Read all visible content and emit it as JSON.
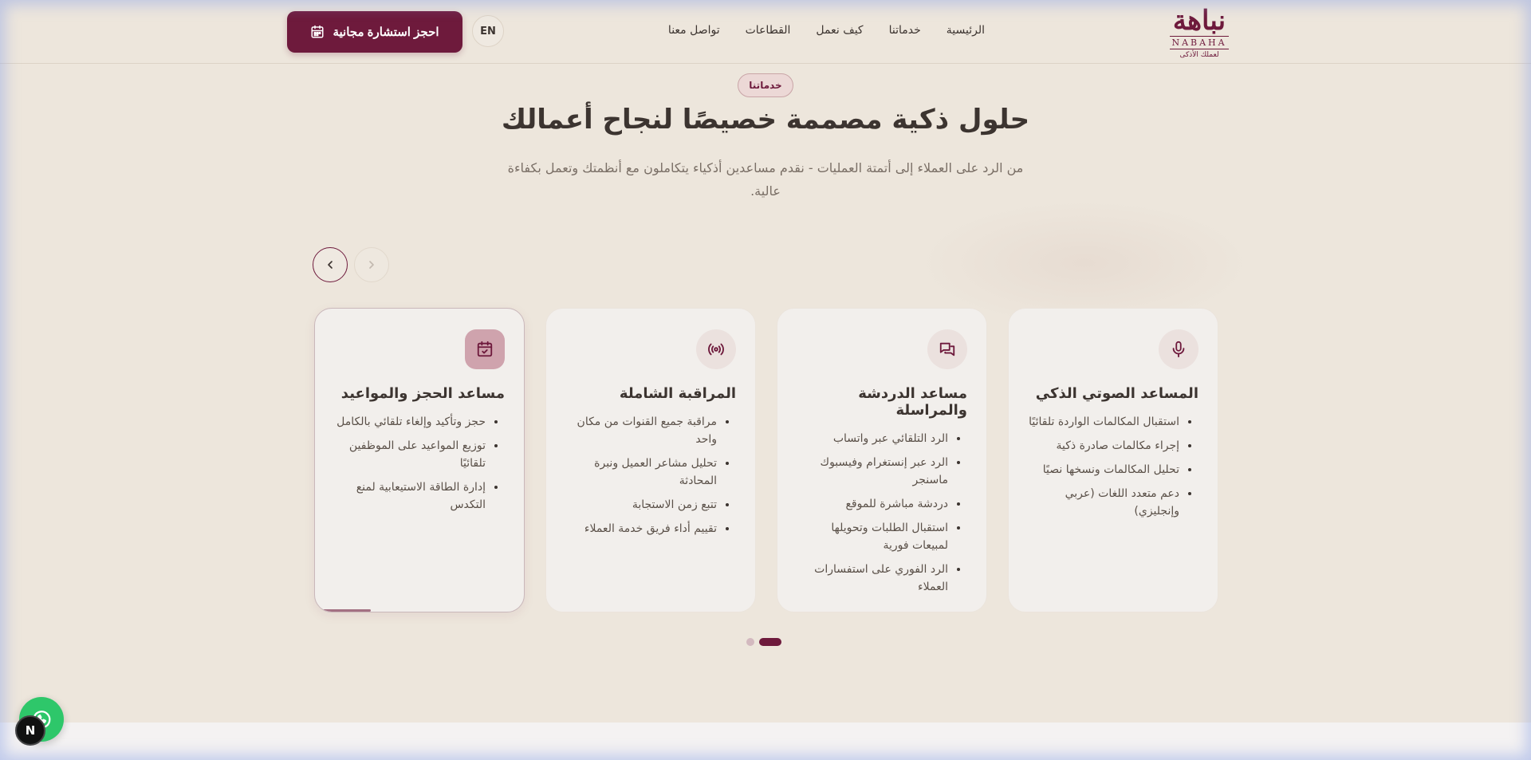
{
  "header": {
    "logo_ar": "نباهة",
    "logo_en": "NABAHA",
    "logo_tagline": "لعملك الأذكى",
    "nav": [
      {
        "label": "الرئيسية"
      },
      {
        "label": "خدماتنا"
      },
      {
        "label": "كيف نعمل"
      },
      {
        "label": "القطاعات"
      },
      {
        "label": "تواصل معنا"
      }
    ],
    "lang_label": "EN",
    "cta_label": "احجز استشارة مجانية"
  },
  "hero": {
    "pill": "خدماتنا",
    "title": "حلول ذكية مصممة خصيصًا لنجاح أعمالك",
    "subtitle": "من الرد على العملاء إلى أتمتة العمليات - نقدم مساعدين أذكياء يتكاملون مع أنظمتك وتعمل بكفاءة عالية."
  },
  "cards": [
    {
      "icon": "microphone-icon",
      "title": "المساعد الصوتي الذكي",
      "items": [
        "استقبال المكالمات الواردة تلقائيًا",
        "إجراء مكالمات صادرة ذكية",
        "تحليل المكالمات ونسخها نصيًا",
        "دعم متعدد اللغات (عربي وإنجليزي)"
      ]
    },
    {
      "icon": "chat-bubbles-icon",
      "title": "مساعد الدردشة والمراسلة",
      "items": [
        "الرد التلقائي عبر واتساب",
        "الرد عبر إنستغرام وفيسبوك ماسنجر",
        "دردشة مباشرة للموقع",
        "استقبال الطلبات وتحويلها لمبيعات فورية",
        "الرد الفوري على استفسارات العملاء"
      ]
    },
    {
      "icon": "broadcast-icon",
      "title": "المراقبة الشاملة",
      "items": [
        "مراقبة جميع القنوات من مكان واحد",
        "تحليل مشاعر العميل ونبرة المحادثة",
        "تتبع زمن الاستجابة",
        "تقييم أداء فريق خدمة العملاء"
      ]
    },
    {
      "icon": "calendar-check-icon",
      "title": "مساعد الحجز والمواعيد",
      "items": [
        "حجز وتأكيد وإلغاء تلقائي بالكامل",
        "توزيع المواعيد على الموظفين تلقائيًا",
        "إدارة الطاقة الاستيعابية لمنع التكدس"
      ]
    }
  ],
  "pagination": {
    "pages": 2,
    "active": 2
  },
  "floating": {
    "badge": "N"
  },
  "colors": {
    "accent": "#6e1a3c",
    "background": "#ede6dc",
    "card": "#f2efec"
  }
}
